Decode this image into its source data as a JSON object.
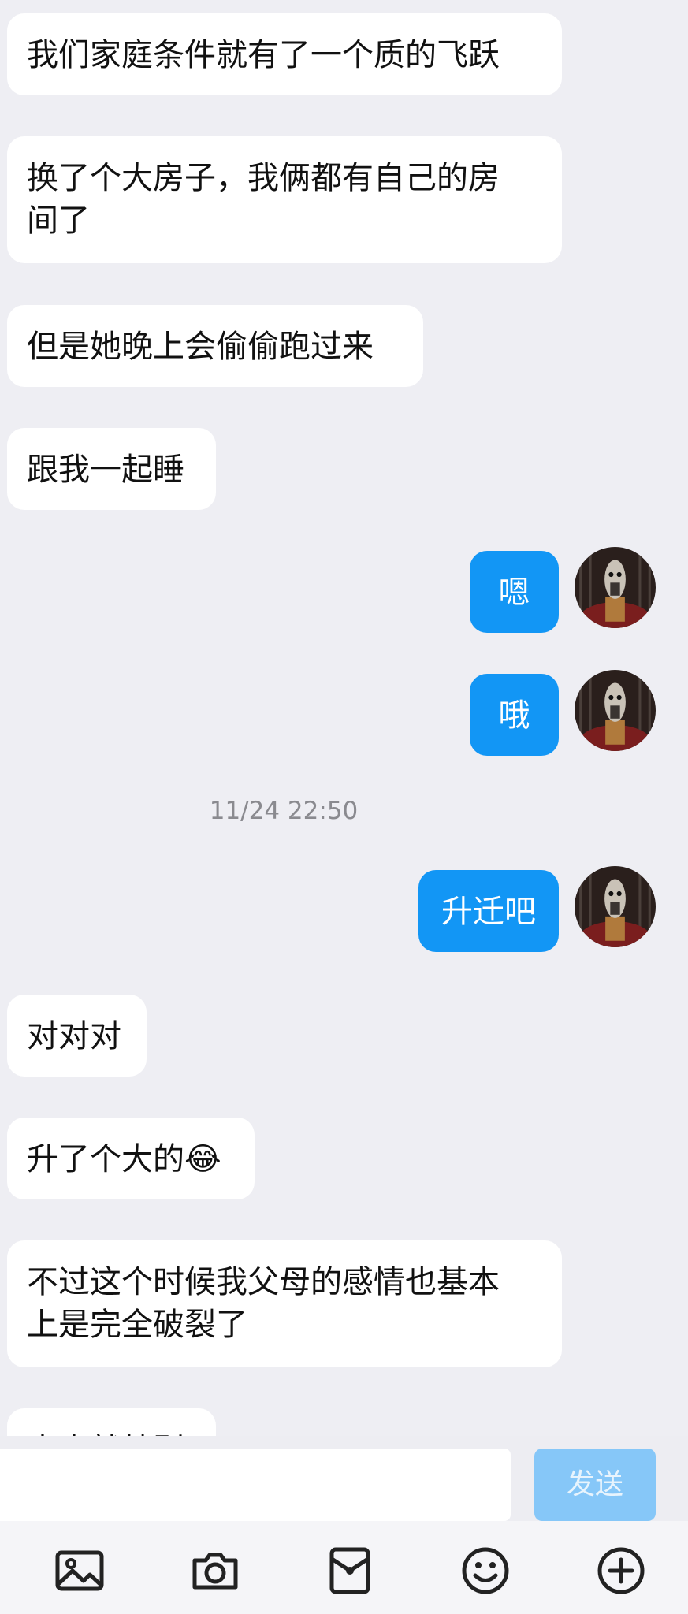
{
  "messages": [
    {
      "side": "left",
      "text": "我们家庭条件就有了一个质的飞跃"
    },
    {
      "side": "left",
      "text": "换了个大房子，我俩都有自己的房\n间了"
    },
    {
      "side": "left",
      "text": "但是她晚上会偷偷跑过来"
    },
    {
      "side": "left",
      "text": "跟我一起睡"
    },
    {
      "side": "right",
      "text": "嗯"
    },
    {
      "side": "right",
      "text": "哦"
    },
    {
      "side": "right",
      "text": "升迁吧"
    },
    {
      "side": "left",
      "text": "对对对"
    },
    {
      "side": "left",
      "text": "升了个大的😂"
    },
    {
      "side": "left",
      "text": "不过这个时候我父母的感情也基本\n上是完全破裂了"
    },
    {
      "side": "left",
      "text": "本来就特别"
    }
  ],
  "timestamp": "11/24 22:50",
  "input": {
    "value": "",
    "send_label": "发送"
  },
  "toolbar": [
    "image-icon",
    "camera-icon",
    "red-packet-icon",
    "emoji-icon",
    "plus-icon"
  ],
  "colors": {
    "own_bubble": "#1296f5",
    "other_bubble": "#ffffff",
    "background": "#eeeef3",
    "send_button": "#86c7f8"
  }
}
